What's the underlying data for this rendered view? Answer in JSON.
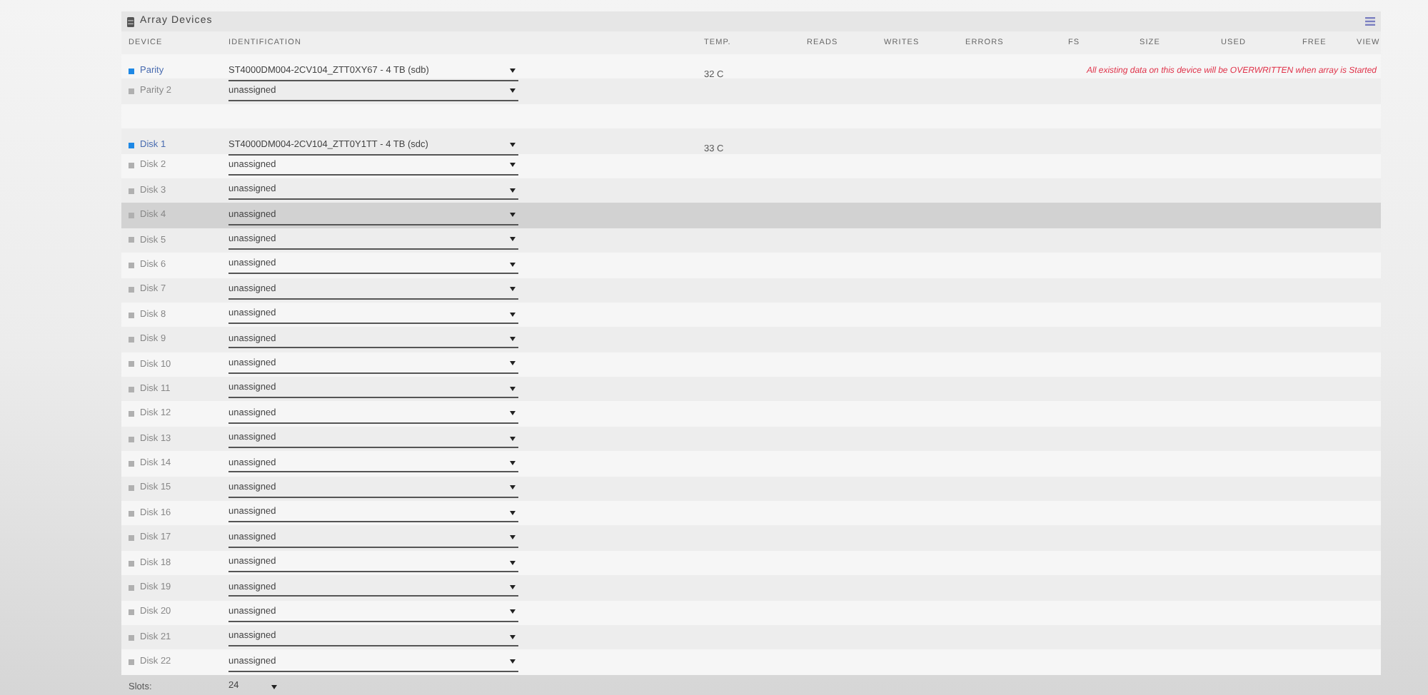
{
  "panel": {
    "title": "Array Devices"
  },
  "columns": [
    "DEVICE",
    "IDENTIFICATION",
    "TEMP.",
    "READS",
    "WRITES",
    "ERRORS",
    "FS",
    "SIZE",
    "USED",
    "FREE",
    "VIEW"
  ],
  "rows": [
    {
      "kind": "device",
      "device": "Parity",
      "assigned": true,
      "color": "#1e88e5",
      "identification": "ST4000DM004-2CV104_ZTT0XY67 - 4 TB (sdb)",
      "temp": "32 C",
      "warning": "All existing data on this device will be OVERWRITTEN when array is Started",
      "hovered": false
    },
    {
      "kind": "device",
      "device": "Parity 2",
      "assigned": false,
      "color": "#b0b0b0",
      "identification": "unassigned",
      "hovered": false
    },
    {
      "kind": "spacer"
    },
    {
      "kind": "device",
      "device": "Disk 1",
      "assigned": true,
      "color": "#1e88e5",
      "identification": "ST4000DM004-2CV104_ZTT0Y1TT - 4 TB (sdc)",
      "temp": "33 C",
      "hovered": false
    },
    {
      "kind": "device",
      "device": "Disk 2",
      "assigned": false,
      "color": "#b0b0b0",
      "identification": "unassigned",
      "hovered": false
    },
    {
      "kind": "device",
      "device": "Disk 3",
      "assigned": false,
      "color": "#b0b0b0",
      "identification": "unassigned",
      "hovered": false
    },
    {
      "kind": "device",
      "device": "Disk 4",
      "assigned": false,
      "color": "#b0b0b0",
      "identification": "unassigned",
      "hovered": true
    },
    {
      "kind": "device",
      "device": "Disk 5",
      "assigned": false,
      "color": "#b0b0b0",
      "identification": "unassigned",
      "hovered": false
    },
    {
      "kind": "device",
      "device": "Disk 6",
      "assigned": false,
      "color": "#b0b0b0",
      "identification": "unassigned",
      "hovered": false
    },
    {
      "kind": "device",
      "device": "Disk 7",
      "assigned": false,
      "color": "#b0b0b0",
      "identification": "unassigned",
      "hovered": false
    },
    {
      "kind": "device",
      "device": "Disk 8",
      "assigned": false,
      "color": "#b0b0b0",
      "identification": "unassigned",
      "hovered": false
    },
    {
      "kind": "device",
      "device": "Disk 9",
      "assigned": false,
      "color": "#b0b0b0",
      "identification": "unassigned",
      "hovered": false
    },
    {
      "kind": "device",
      "device": "Disk 10",
      "assigned": false,
      "color": "#b0b0b0",
      "identification": "unassigned",
      "hovered": false
    },
    {
      "kind": "device",
      "device": "Disk 11",
      "assigned": false,
      "color": "#b0b0b0",
      "identification": "unassigned",
      "hovered": false
    },
    {
      "kind": "device",
      "device": "Disk 12",
      "assigned": false,
      "color": "#b0b0b0",
      "identification": "unassigned",
      "hovered": false
    },
    {
      "kind": "device",
      "device": "Disk 13",
      "assigned": false,
      "color": "#b0b0b0",
      "identification": "unassigned",
      "hovered": false
    },
    {
      "kind": "device",
      "device": "Disk 14",
      "assigned": false,
      "color": "#b0b0b0",
      "identification": "unassigned",
      "hovered": false
    },
    {
      "kind": "device",
      "device": "Disk 15",
      "assigned": false,
      "color": "#b0b0b0",
      "identification": "unassigned",
      "hovered": false
    },
    {
      "kind": "device",
      "device": "Disk 16",
      "assigned": false,
      "color": "#b0b0b0",
      "identification": "unassigned",
      "hovered": false
    },
    {
      "kind": "device",
      "device": "Disk 17",
      "assigned": false,
      "color": "#b0b0b0",
      "identification": "unassigned",
      "hovered": false
    },
    {
      "kind": "device",
      "device": "Disk 18",
      "assigned": false,
      "color": "#b0b0b0",
      "identification": "unassigned",
      "hovered": false
    },
    {
      "kind": "device",
      "device": "Disk 19",
      "assigned": false,
      "color": "#b0b0b0",
      "identification": "unassigned",
      "hovered": false
    },
    {
      "kind": "device",
      "device": "Disk 20",
      "assigned": false,
      "color": "#b0b0b0",
      "identification": "unassigned",
      "hovered": false
    },
    {
      "kind": "device",
      "device": "Disk 21",
      "assigned": false,
      "color": "#b0b0b0",
      "identification": "unassigned",
      "hovered": false
    },
    {
      "kind": "device",
      "device": "Disk 22",
      "assigned": false,
      "color": "#b0b0b0",
      "identification": "unassigned",
      "hovered": false
    }
  ],
  "slots": {
    "label": "Slots:",
    "value": "24"
  }
}
